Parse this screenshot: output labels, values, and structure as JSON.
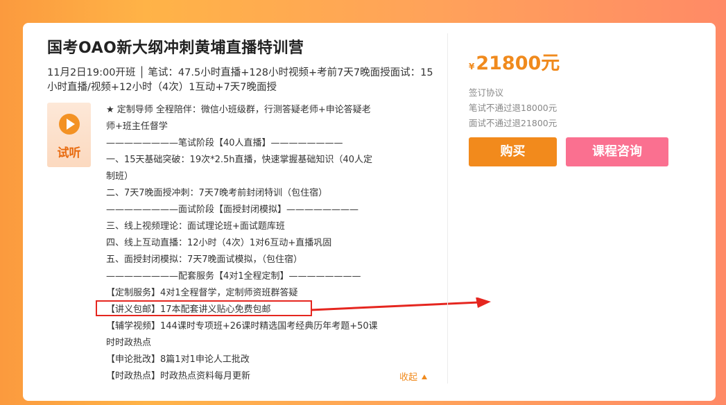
{
  "course": {
    "title": "国考OAO新大纲冲刺黄埔直播特训营",
    "subtitle": "11月2日19:00开班 │ 笔试：47.5小时直播+128小时视频+考前7天7晚面授面试：15小时直播/视频+12小时（4次）1互动+7天7晚面授"
  },
  "trial": {
    "label": "试听",
    "icon": "play-icon"
  },
  "description": [
    "★ 定制导师 全程陪伴：微信小班级群，行测答疑老师+申论答疑老",
    "师+班主任督学",
    "————————笔试阶段【40人直播】————————",
    "一、15天基础突破：19次*2.5h直播，快速掌握基础知识（40人定",
    "制班）",
    "二、7天7晚面授冲刺：7天7晚考前封闭特训（包住宿）",
    "————————面试阶段【面授封闭模拟】————————",
    "三、线上视频理论：面试理论班+面试题库班",
    "四、线上互动直播：12小时（4次）1对6互动+直播巩固",
    "五、面授封闭模拟：7天7晚面试模拟，（包住宿）",
    "————————配套服务【4对1全程定制】————————",
    "【定制服务】4对1全程督学，定制师资班群答疑",
    "【讲义包邮】17本配套讲义贴心免费包邮",
    "【辅学视频】144课时专项班+26课时精选国考经典历年考题+50课",
    "时时政热点",
    "【申论批改】8篇1对1申论人工批改",
    "【时政热点】时政热点资料每月更新"
  ],
  "collapse_label": "收起",
  "pricing": {
    "currency": "¥",
    "amount": "21800元",
    "notes": [
      "签订协议",
      "笔试不通过退18000元",
      "面试不通过退21800元"
    ]
  },
  "buttons": {
    "buy": "购买",
    "consult": "课程咨询"
  },
  "colors": {
    "accent": "#f08a1d",
    "buy_button": "#f28a1c",
    "consult_button": "#fa7090",
    "highlight_box": "#e5261f"
  }
}
